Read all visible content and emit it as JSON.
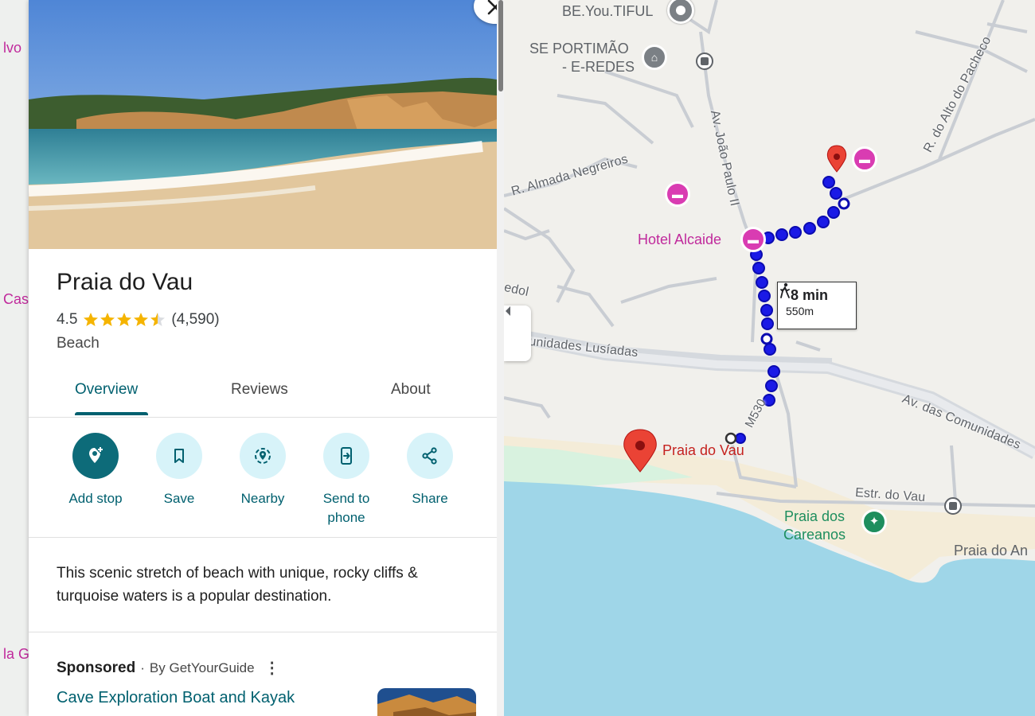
{
  "panel": {
    "place_title": "Praia do Vau",
    "rating": "4.5",
    "review_count": "(4,590)",
    "category": "Beach",
    "tabs": [
      "Overview",
      "Reviews",
      "About"
    ],
    "active_tab": "Overview",
    "actions": [
      {
        "label": "Add stop",
        "icon": "add-stop-icon"
      },
      {
        "label": "Save",
        "icon": "bookmark-icon"
      },
      {
        "label": "Nearby",
        "icon": "nearby-icon"
      },
      {
        "label": "Send to phone",
        "icon": "send-to-phone-icon"
      },
      {
        "label": "Share",
        "icon": "share-icon"
      }
    ],
    "description": "This scenic stretch of beach with unique, rocky cliffs & turquoise waters is a popular destination.",
    "sponsored": {
      "label": "Sponsored",
      "by": "By GetYourGuide",
      "title": "Cave Exploration Boat and Kayak"
    }
  },
  "map": {
    "labels": {
      "beyoutiful": "BE.You.TIFUL",
      "se_portimao": "SE PORTIMÃO",
      "e_redes": "- E-REDES",
      "av_joao_paulo": "Av. João Paulo II",
      "r_almada": "R. Almada Negreiros",
      "r_alto_pacheco": "R. do Alto do Pacheco",
      "hotel_alcaide": "Hotel Alcaide",
      "edol": "edol",
      "av_comunidades_lusiadas": "unidades Lusíadas",
      "av_das_comunidades": "Av. das Comunidades",
      "m530": "M530",
      "praia_do_vau": "Praia do Vau",
      "estr_do_vau": "Estr. do Vau",
      "praia_dos_careanos": "Praia dos\nCareanos",
      "praia_do_an": "Praia do An",
      "edge_lvo": "lvo",
      "edge_cas": "Cas",
      "edge_la_g": "la G"
    },
    "walk": {
      "time": "8 min",
      "distance": "550m"
    },
    "colors": {
      "route": "#1a1ae6",
      "sea": "#9fd6e8",
      "land": "#f1f0ec",
      "beach": "#f4ecd8",
      "hotel_pin": "#d93cb2",
      "place_pin": "#ea4335"
    }
  }
}
